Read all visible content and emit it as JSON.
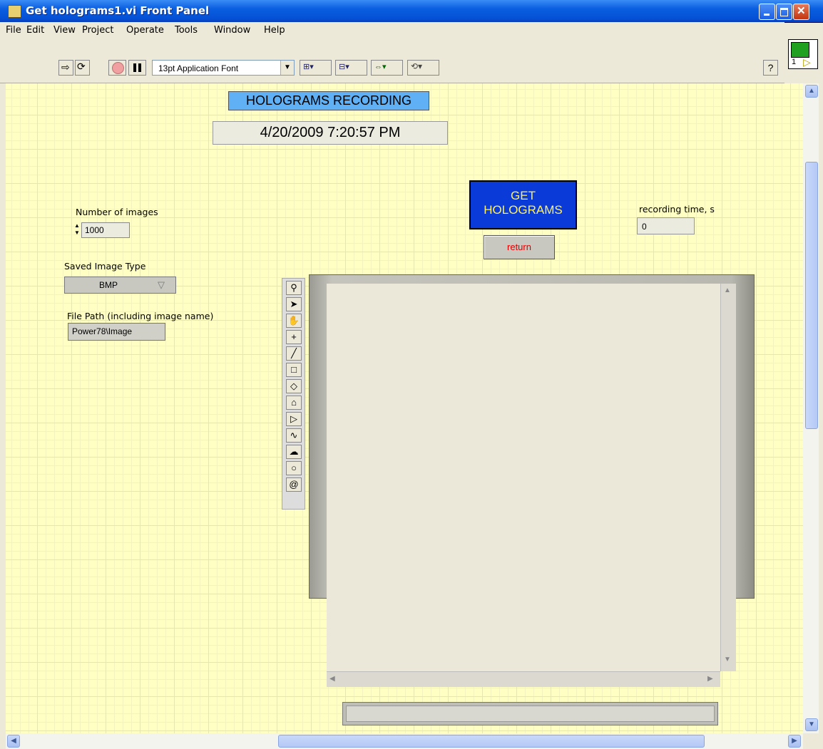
{
  "window": {
    "title": "Get holograms1.vi Front Panel"
  },
  "menu": [
    "File",
    "Edit",
    "View",
    "Project",
    "Operate",
    "Tools",
    "Window",
    "Help"
  ],
  "toolbar": {
    "font": "13pt Application Font",
    "help": "?"
  },
  "panel": {
    "title": "HOLOGRAMS RECORDING",
    "datetime": "4/20/2009 7:20:57 PM",
    "get_button": {
      "line1": "GET",
      "line2": "HOLOGRAMS"
    },
    "return_button": "return",
    "recording_time": {
      "label": "recording time, s",
      "value": "0"
    },
    "num_images": {
      "label": "Number of images",
      "value": "1000"
    },
    "image_type": {
      "label": "Saved Image Type",
      "value": "BMP"
    },
    "file_path": {
      "label": "File Path (including image name)",
      "value": "Power78\\Image"
    }
  },
  "vi_icon": {
    "number": "1"
  },
  "colors": {
    "panel_bg": "#ffffc4",
    "title_bg": "#5fb0f5",
    "get_btn_bg": "#0a3ad8",
    "get_btn_text": "#fff066",
    "return_text": "#e00000"
  }
}
